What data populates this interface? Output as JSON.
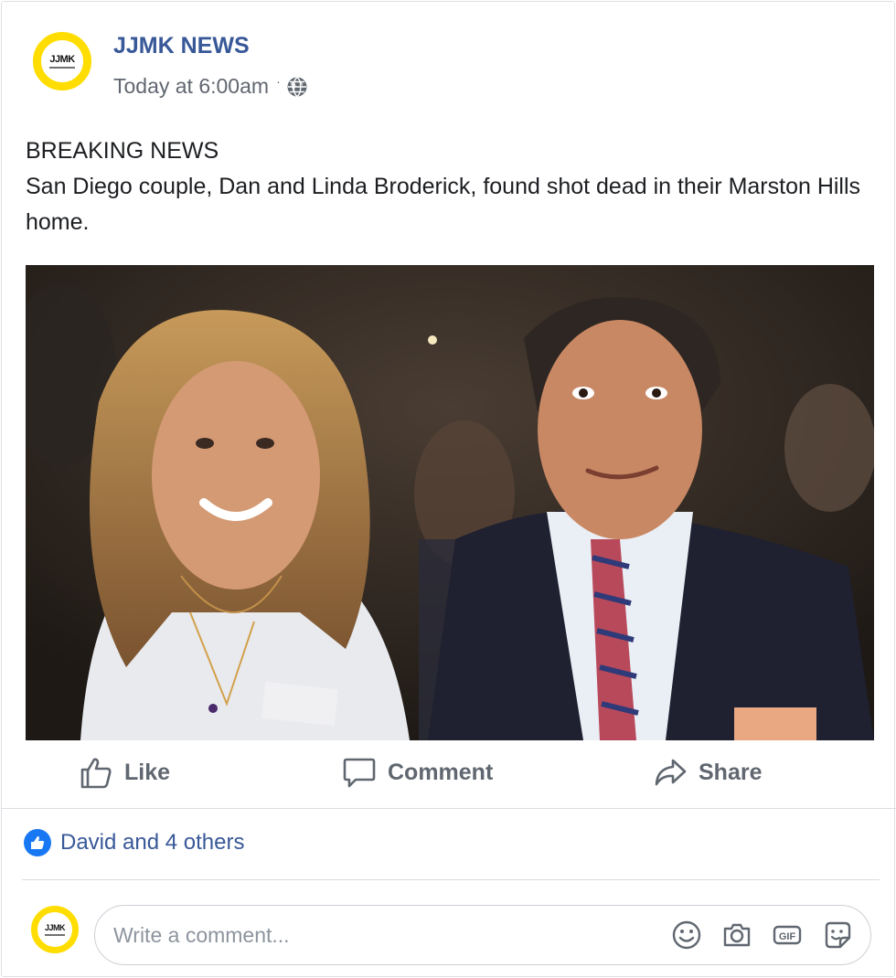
{
  "post": {
    "page_name": "JJMK NEWS",
    "logo_text": "JJMK",
    "timestamp": "Today at 6:00am",
    "separator": "·",
    "text_line1": "BREAKING NEWS",
    "text_line2": "San Diego couple, Dan and Linda Broderick, found shot dead in their Marston Hills home."
  },
  "actions": {
    "like": "Like",
    "comment": "Comment",
    "share": "Share"
  },
  "reactions": {
    "summary": "David and 4 others"
  },
  "comment_box": {
    "placeholder": "Write a comment..."
  },
  "colors": {
    "brand_blue": "#385898",
    "logo_yellow": "#ffdd00",
    "like_blue": "#1877f2"
  },
  "icons": [
    "globe-icon",
    "like-icon",
    "comment-icon",
    "share-icon",
    "like-badge-icon",
    "emoji-icon",
    "camera-icon",
    "gif-icon",
    "sticker-icon"
  ]
}
